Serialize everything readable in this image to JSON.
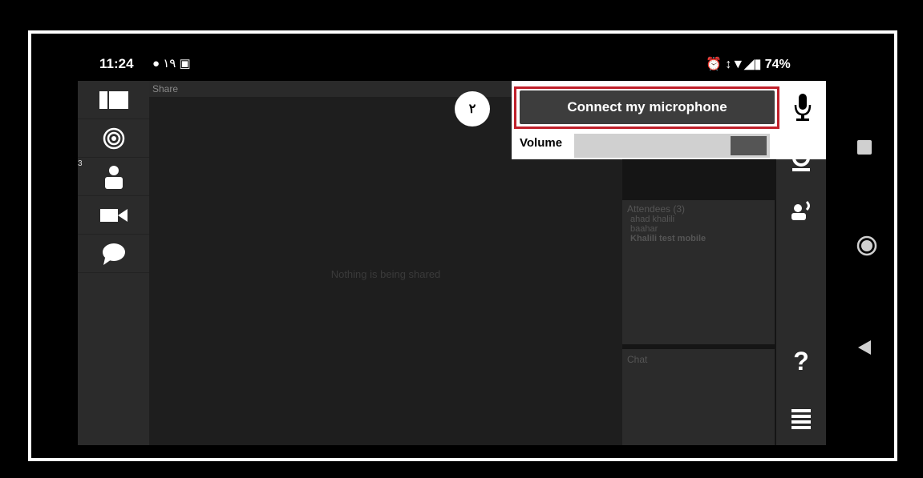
{
  "status_bar": {
    "time": "11:24",
    "left_icons": "● ۱۹ ▣",
    "right_text": "⏰ ↕▼◢▮ 74%"
  },
  "share": {
    "header": "Share",
    "empty_message": "Nothing is being shared"
  },
  "step_badge": "۲",
  "audio": {
    "connect_label": "Connect my microphone",
    "volume_label": "Volume"
  },
  "attendees": {
    "title": "Attendees (3)",
    "list": [
      "ahad khalili",
      "baahar",
      "Khalili test mobile"
    ]
  },
  "chat": {
    "title": "Chat"
  },
  "left_badge": "3",
  "help_icon": "?"
}
